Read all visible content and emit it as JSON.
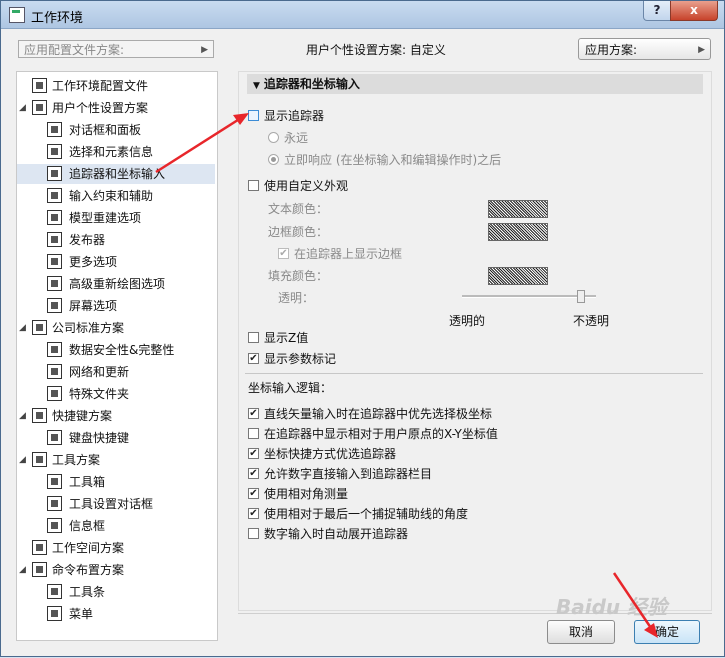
{
  "window": {
    "title": "工作环境",
    "help_label": "?",
    "close_label": "x"
  },
  "profile": {
    "dropdown_placeholder": "应用配置文件方案:",
    "status": "用户个性设置方案:  自定义",
    "apply_label": "应用方案:"
  },
  "tree": [
    {
      "label": "工作环境配置文件",
      "level": 0,
      "expander": ""
    },
    {
      "label": "用户个性设置方案",
      "level": 0,
      "expander": "◢"
    },
    {
      "label": "对话框和面板",
      "level": 1,
      "expander": ""
    },
    {
      "label": "选择和元素信息",
      "level": 1,
      "expander": ""
    },
    {
      "label": "追踪器和坐标输入",
      "level": 1,
      "expander": "",
      "selected": true
    },
    {
      "label": "输入约束和辅助",
      "level": 1,
      "expander": ""
    },
    {
      "label": "模型重建选项",
      "level": 1,
      "expander": ""
    },
    {
      "label": "发布器",
      "level": 1,
      "expander": ""
    },
    {
      "label": "更多选项",
      "level": 1,
      "expander": ""
    },
    {
      "label": "高级重新绘图选项",
      "level": 1,
      "expander": ""
    },
    {
      "label": "屏幕选项",
      "level": 1,
      "expander": ""
    },
    {
      "label": "公司标准方案",
      "level": 0,
      "expander": "◢"
    },
    {
      "label": "数据安全性&完整性",
      "level": 1,
      "expander": ""
    },
    {
      "label": "网络和更新",
      "level": 1,
      "expander": ""
    },
    {
      "label": "特殊文件夹",
      "level": 1,
      "expander": ""
    },
    {
      "label": "快捷键方案",
      "level": 0,
      "expander": "◢"
    },
    {
      "label": "键盘快捷键",
      "level": 1,
      "expander": ""
    },
    {
      "label": "工具方案",
      "level": 0,
      "expander": "◢"
    },
    {
      "label": "工具箱",
      "level": 1,
      "expander": ""
    },
    {
      "label": "工具设置对话框",
      "level": 1,
      "expander": ""
    },
    {
      "label": "信息框",
      "level": 1,
      "expander": ""
    },
    {
      "label": "工作空间方案",
      "level": 0,
      "expander": ""
    },
    {
      "label": "命令布置方案",
      "level": 0,
      "expander": "◢"
    },
    {
      "label": "工具条",
      "level": 1,
      "expander": ""
    },
    {
      "label": "菜单",
      "level": 1,
      "expander": ""
    }
  ],
  "panel": {
    "section_title": "追踪器和坐标输入",
    "show_tracker": "显示追踪器",
    "radio_always": "永远",
    "radio_immediate": "立即响应 (在坐标输入和编辑操作时)之后",
    "custom_appearance": "使用自定义外观",
    "text_color": "文本颜色：",
    "border_color": "边框颜色：",
    "show_border": "在追踪器上显示边框",
    "fill_color": "填充颜色：",
    "transparency": "透明：",
    "transparent": "透明的",
    "opaque": "不透明",
    "show_z": "显示Z值",
    "show_param": "显示参数标记",
    "coord_logic": "坐标输入逻辑：",
    "options": [
      {
        "label": "直线矢量输入时在追踪器中优先选择极坐标",
        "checked": true
      },
      {
        "label": "在追踪器中显示相对于用户原点的X-Y坐标值",
        "checked": false
      },
      {
        "label": "坐标快捷方式优选追踪器",
        "checked": true
      },
      {
        "label": "允许数字直接输入到追踪器栏目",
        "checked": true
      },
      {
        "label": "使用相对角测量",
        "checked": true
      },
      {
        "label": "使用相对于最后一个捕捉辅助线的角度",
        "checked": true
      },
      {
        "label": "数字输入时自动展开追踪器",
        "checked": false
      }
    ]
  },
  "buttons": {
    "cancel": "取消",
    "ok": "确定"
  },
  "watermark": "Baidu 经验",
  "accent_color": "#e8262b"
}
